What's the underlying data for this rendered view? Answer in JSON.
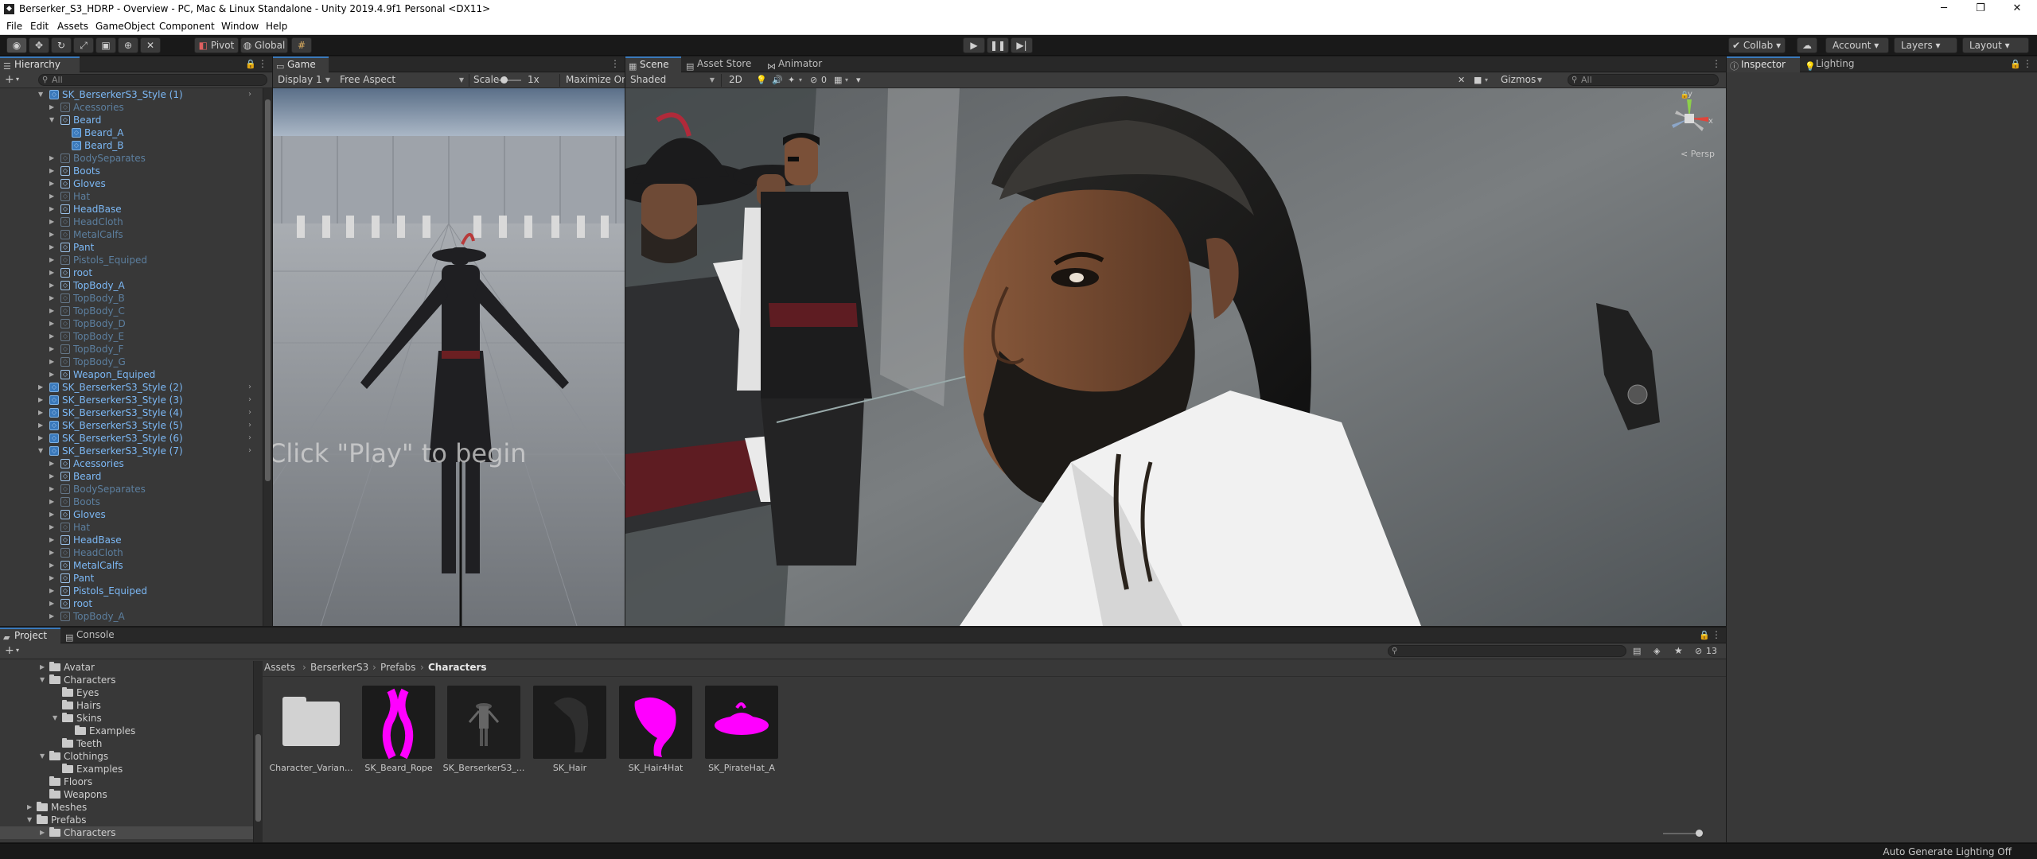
{
  "window": {
    "title": "Berserker_S3_HDRP - Overview - PC, Mac & Linux Standalone - Unity 2019.4.9f1 Personal <DX11>"
  },
  "menu": [
    "File",
    "Edit",
    "Assets",
    "GameObject",
    "Component",
    "Window",
    "Help"
  ],
  "toolbar": {
    "pivot": "Pivot",
    "global": "Global",
    "collab": "Collab",
    "account": "Account",
    "layers": "Layers",
    "layout": "Layout"
  },
  "hierarchy": {
    "tab": "Hierarchy",
    "search_placeholder": "All",
    "rows": [
      {
        "label": "SK_BerserkerS3_Style (1)"
      },
      {
        "label": "Acessories"
      },
      {
        "label": "Beard"
      },
      {
        "label": "Beard_A"
      },
      {
        "label": "Beard_B"
      },
      {
        "label": "BodySeparates"
      },
      {
        "label": "Boots"
      },
      {
        "label": "Gloves"
      },
      {
        "label": "Hat"
      },
      {
        "label": "HeadBase"
      },
      {
        "label": "HeadCloth"
      },
      {
        "label": "MetalCalfs"
      },
      {
        "label": "Pant"
      },
      {
        "label": "Pistols_Equiped"
      },
      {
        "label": "root"
      },
      {
        "label": "TopBody_A"
      },
      {
        "label": "TopBody_B"
      },
      {
        "label": "TopBody_C"
      },
      {
        "label": "TopBody_D"
      },
      {
        "label": "TopBody_E"
      },
      {
        "label": "TopBody_F"
      },
      {
        "label": "TopBody_G"
      },
      {
        "label": "Weapon_Equiped"
      },
      {
        "label": "SK_BerserkerS3_Style (2)"
      },
      {
        "label": "SK_BerserkerS3_Style (3)"
      },
      {
        "label": "SK_BerserkerS3_Style (4)"
      },
      {
        "label": "SK_BerserkerS3_Style (5)"
      },
      {
        "label": "SK_BerserkerS3_Style (6)"
      },
      {
        "label": "SK_BerserkerS3_Style (7)"
      },
      {
        "label": "Acessories"
      },
      {
        "label": "Beard"
      },
      {
        "label": "BodySeparates"
      },
      {
        "label": "Boots"
      },
      {
        "label": "Gloves"
      },
      {
        "label": "Hat"
      },
      {
        "label": "HeadBase"
      },
      {
        "label": "HeadCloth"
      },
      {
        "label": "MetalCalfs"
      },
      {
        "label": "Pant"
      },
      {
        "label": "Pistols_Equiped"
      },
      {
        "label": "root"
      },
      {
        "label": "TopBody_A"
      }
    ]
  },
  "game": {
    "tab": "Game",
    "display": "Display 1",
    "aspect": "Free Aspect",
    "scale_label": "Scale",
    "scale_value": "1x",
    "maximize": "Maximize On",
    "overlay_text": "Click \"Play\" to begin"
  },
  "scene": {
    "tabs": [
      "Scene",
      "Asset Store",
      "Animator"
    ],
    "shading": "Shaded",
    "mode_2d": "2D",
    "fx_count": "0",
    "gizmos": "Gizmos",
    "search_placeholder": "All",
    "persp": "Persp",
    "axis_y": "y",
    "axis_x": "x"
  },
  "inspector": {
    "tabs": [
      "Inspector",
      "Lighting"
    ]
  },
  "project": {
    "tabs": [
      "Project",
      "Console"
    ],
    "tree": [
      {
        "label": "Avatar"
      },
      {
        "label": "Characters"
      },
      {
        "label": "Eyes"
      },
      {
        "label": "Hairs"
      },
      {
        "label": "Skins"
      },
      {
        "label": "Examples"
      },
      {
        "label": "Teeth"
      },
      {
        "label": "Clothings"
      },
      {
        "label": "Examples"
      },
      {
        "label": "Floors"
      },
      {
        "label": "Weapons"
      },
      {
        "label": "Meshes"
      },
      {
        "label": "Prefabs"
      },
      {
        "label": "Characters"
      }
    ],
    "breadcrumb": [
      "Assets",
      "BerserkerS3",
      "Prefabs",
      "Characters"
    ],
    "assets": [
      {
        "label": "Character_Varian..."
      },
      {
        "label": "SK_Beard_Rope"
      },
      {
        "label": "SK_BerserkerS3_..."
      },
      {
        "label": "SK_Hair"
      },
      {
        "label": "SK_Hair4Hat"
      },
      {
        "label": "SK_PirateHat_A"
      }
    ],
    "hidden_count": "13"
  },
  "status": {
    "text": "Auto Generate Lighting Off"
  },
  "colors": {
    "accent": "#3a79bb",
    "missing_material": "#ff00ff",
    "hierarchy_link": "#7cb8f5"
  }
}
